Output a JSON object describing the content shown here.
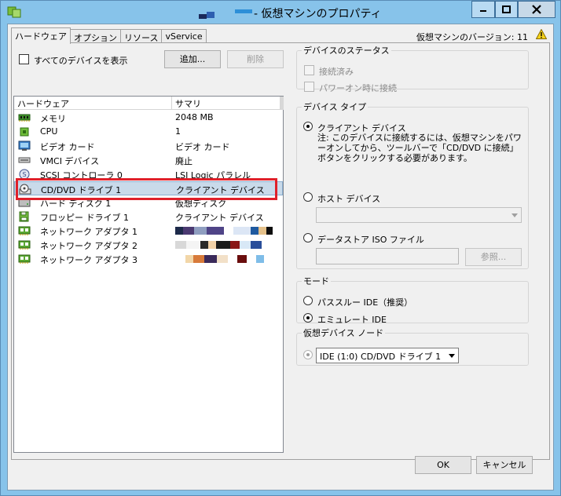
{
  "window": {
    "title": "- 仮想マシンのプロパティ",
    "colors": {
      "frame": "#87c3ea",
      "selection": "#c9daea",
      "highlight_box": "#e0202a"
    }
  },
  "tabs": [
    {
      "label": "ハードウェア",
      "active": true
    },
    {
      "label": "オプション",
      "active": false
    },
    {
      "label": "リソース",
      "active": false
    },
    {
      "label": "vService",
      "active": false
    }
  ],
  "version": {
    "label": "仮想マシンのバージョン: 11",
    "icon": "warning-icon"
  },
  "hardware": {
    "show_all_label": "すべてのデバイスを表示",
    "add_button": "追加...",
    "remove_button": "削除",
    "columns": {
      "hardware": "ハードウェア",
      "summary": "サマリ"
    },
    "rows": [
      {
        "name": "メモリ",
        "summary": "2048 MB",
        "icon": "memory-icon"
      },
      {
        "name": "CPU",
        "summary": "1",
        "icon": "cpu-icon"
      },
      {
        "name": "ビデオ カード",
        "summary": "ビデオ カード",
        "icon": "video-card-icon"
      },
      {
        "name": "VMCI デバイス",
        "summary": "廃止",
        "icon": "vmci-icon"
      },
      {
        "name": "SCSI コントローラ 0",
        "summary": "LSI Logic パラレル",
        "icon": "scsi-controller-icon"
      },
      {
        "name": "CD/DVD ドライブ 1",
        "summary": "クライアント デバイス",
        "icon": "cd-dvd-icon",
        "selected": true
      },
      {
        "name": "ハード ディスク 1",
        "summary": "仮想ディスク",
        "icon": "hard-disk-icon"
      },
      {
        "name": "フロッピー ドライブ 1",
        "summary": "クライアント デバイス",
        "icon": "floppy-icon"
      },
      {
        "name": "ネットワーク アダプタ 1",
        "summary": "",
        "icon": "network-adapter-icon"
      },
      {
        "name": "ネットワーク アダプタ 2",
        "summary": "",
        "icon": "network-adapter-icon"
      },
      {
        "name": "ネットワーク アダプタ 3",
        "summary": "",
        "icon": "network-adapter-icon"
      }
    ]
  },
  "device_status": {
    "legend": "デバイスのステータス",
    "connected": "接続済み",
    "connect_at_power_on": "パワーオン時に接続"
  },
  "device_type": {
    "legend": "デバイス タイプ",
    "client_device": "クライアント デバイス",
    "client_note": "注: このデバイスに接続するには、仮想マシンをパワーオンしてから、ツールバーで「CD/DVD に接続」ボタンをクリックする必要があります。",
    "host_device": "ホスト デバイス",
    "datastore_iso": "データストア ISO ファイル",
    "browse_button": "参照..."
  },
  "mode": {
    "legend": "モード",
    "passthrough": "パススルー IDE（推奨）",
    "emulate": "エミュレート IDE"
  },
  "virtual_node": {
    "legend": "仮想デバイス ノード",
    "value": "IDE (1:0) CD/DVD ドライブ 1"
  },
  "footer": {
    "ok": "OK",
    "cancel": "キャンセル"
  }
}
